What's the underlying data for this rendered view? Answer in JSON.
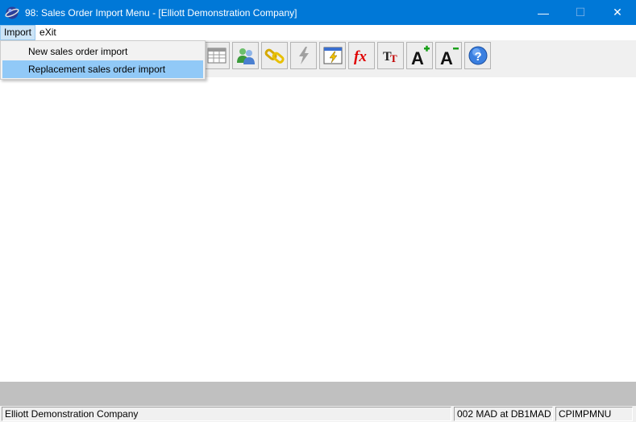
{
  "window": {
    "title": "98: Sales Order Import Menu - [Elliott Demonstration Company]",
    "minimize_glyph": "—",
    "maximize_glyph": "☐",
    "close_glyph": "✕"
  },
  "menu": {
    "items": [
      {
        "label": "Import"
      },
      {
        "label": "eXit"
      }
    ]
  },
  "dropdown": {
    "items": [
      {
        "label": "New sales order import"
      },
      {
        "label": "Replacement sales order import"
      }
    ]
  },
  "toolbar": {
    "icons": [
      "grid-icon",
      "users-icon",
      "link-icon",
      "lightning-icon",
      "window-lightning-icon",
      "fx-icon",
      "font-tt-icon",
      "font-increase-icon",
      "font-decrease-icon",
      "help-icon"
    ]
  },
  "statusbar": {
    "company": "Elliott Demonstration Company",
    "database": "002 MAD at DB1MAD",
    "program": "CPIMPMNU"
  },
  "colors": {
    "titlebar": "#0078d7",
    "menu_highlight": "#91c9f7"
  }
}
